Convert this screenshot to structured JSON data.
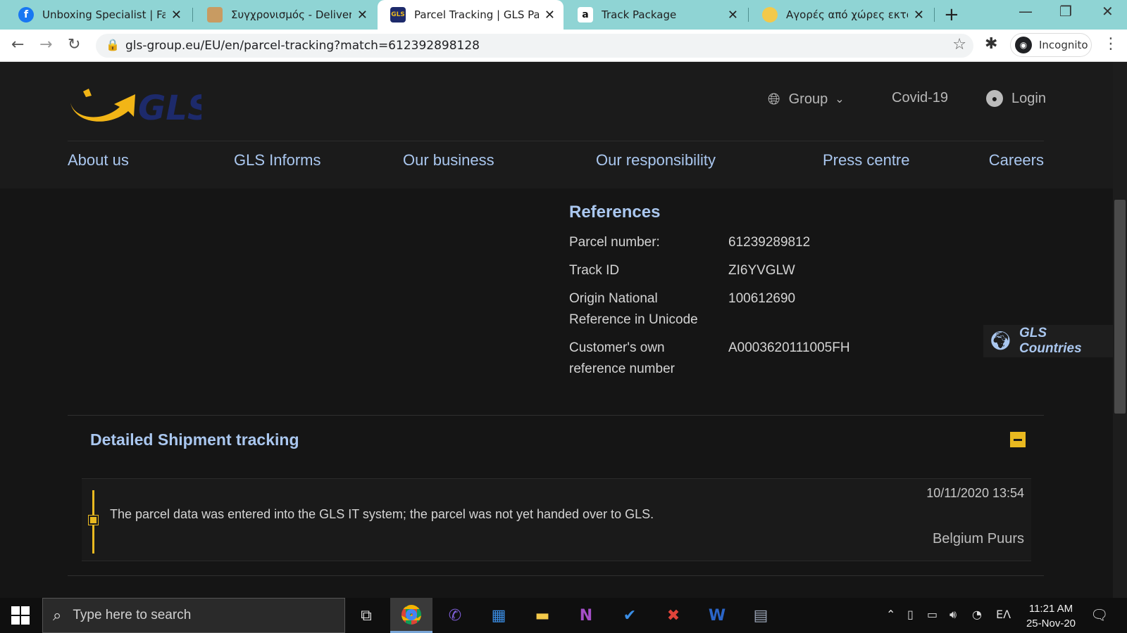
{
  "browser": {
    "tabs": [
      {
        "title": "Unboxing Specialist | Faceb",
        "icon": "facebook-icon"
      },
      {
        "title": "Συγχρονισμός - Deliveries F",
        "icon": "package-icon"
      },
      {
        "title": "Parcel Tracking | GLS Parcel",
        "icon": "gls-icon",
        "active": true
      },
      {
        "title": "Track Package",
        "icon": "amazon-icon"
      },
      {
        "title": "Αγορές από χώρες εκτός Ε",
        "icon": "shopping-icon"
      }
    ],
    "url": "gls-group.eu/EU/en/parcel-tracking?match=612392898128",
    "profile_label": "Incognito"
  },
  "site": {
    "logo_text": "GLS",
    "utility": {
      "group_label": "Group",
      "covid_label": "Covid-19",
      "login_label": "Login"
    },
    "nav": [
      "About us",
      "GLS Informs",
      "Our business",
      "Our responsibility",
      "Press centre",
      "Careers"
    ],
    "references": {
      "title": "References",
      "rows": [
        {
          "label": "Parcel number:",
          "value": "61239289812"
        },
        {
          "label": "Track ID",
          "value": "ZI6YVGLW"
        },
        {
          "label": "Origin National Reference in Unicode",
          "value": "100612690"
        },
        {
          "label": "Customer's own reference number",
          "value": "A0003620111005FH"
        }
      ]
    },
    "countries_label": "GLS Countries",
    "tracking": {
      "title": "Detailed Shipment tracking",
      "events": [
        {
          "datetime": "10/11/2020 13:54",
          "description": "The parcel data was entered into the GLS IT system; the parcel was not yet handed over to GLS.",
          "location": "Belgium Puurs"
        }
      ]
    }
  },
  "taskbar": {
    "search_placeholder": "Type here to search",
    "language": "ΕΛ",
    "time": "11:21 AM",
    "date": "25-Nov-20"
  },
  "colors": {
    "accent_yellow": "#e9b920",
    "link_blue": "#aac7ef",
    "tab_bar": "#8fd4d4",
    "gls_navy": "#1d2a6b"
  }
}
